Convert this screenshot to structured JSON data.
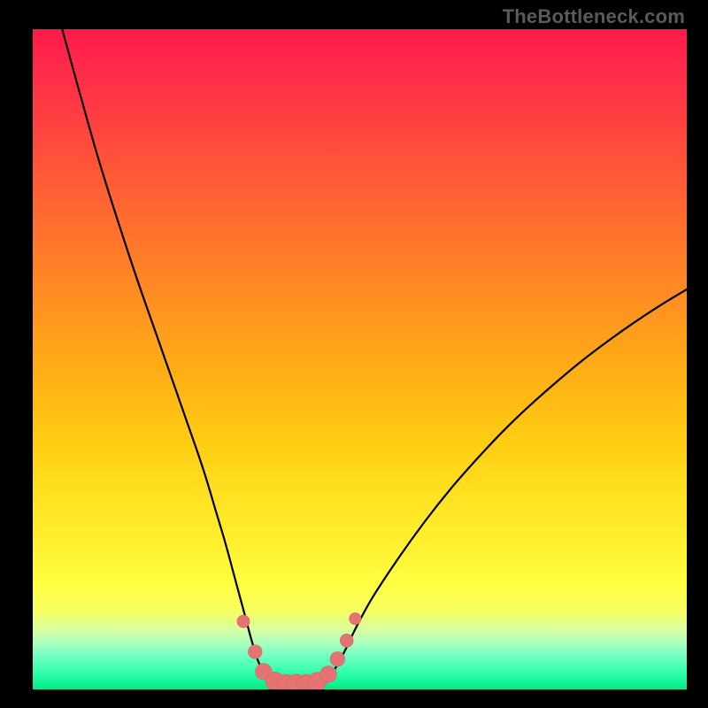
{
  "watermark": "TheBottleneck.com",
  "colors": {
    "background": "#000000",
    "curve": "#000000",
    "marker_fill": "#e57373",
    "marker_stroke": "#d86a6a",
    "gradient_top": "#ff1a4a",
    "gradient_bottom": "#08e888"
  },
  "chart_data": {
    "type": "line",
    "title": "",
    "xlabel": "",
    "ylabel": "",
    "xlim": [
      0,
      100
    ],
    "ylim": [
      0,
      100
    ],
    "grid": false,
    "legend": false,
    "series": [
      {
        "name": "left-branch",
        "x": [
          4.5,
          7,
          10,
          13,
          16,
          19,
          22,
          25,
          26.5,
          28,
          29.5,
          31,
          32.5,
          33.5,
          34.5,
          36
        ],
        "y": [
          100,
          91,
          80.5,
          71,
          62,
          53.5,
          45,
          36.5,
          32,
          27,
          22,
          16.5,
          11,
          7.3,
          4.2,
          1.2
        ]
      },
      {
        "name": "valley",
        "x": [
          36,
          37.5,
          39,
          40.5,
          42,
          43.5,
          45
        ],
        "y": [
          1.2,
          0.5,
          0.25,
          0.2,
          0.25,
          0.55,
          1.2
        ]
      },
      {
        "name": "right-branch",
        "x": [
          45,
          46.5,
          48,
          49.5,
          52,
          56,
          60,
          64,
          68,
          72,
          76,
          80,
          84,
          88,
          92,
          96,
          100
        ],
        "y": [
          1.2,
          3.6,
          6.4,
          9.5,
          14,
          20,
          25.5,
          30.5,
          35,
          39.2,
          43,
          46.5,
          49.8,
          52.8,
          55.6,
          58.2,
          60.6
        ]
      }
    ],
    "markers": [
      {
        "x": 32.2,
        "y": 10.3,
        "r": 0.95
      },
      {
        "x": 34.0,
        "y": 5.7,
        "r": 1.05
      },
      {
        "x": 35.3,
        "y": 2.7,
        "r": 1.25
      },
      {
        "x": 37.0,
        "y": 1.25,
        "r": 1.4
      },
      {
        "x": 38.8,
        "y": 0.85,
        "r": 1.4
      },
      {
        "x": 40.3,
        "y": 0.8,
        "r": 1.5
      },
      {
        "x": 41.8,
        "y": 0.85,
        "r": 1.4
      },
      {
        "x": 43.5,
        "y": 1.2,
        "r": 1.4
      },
      {
        "x": 45.2,
        "y": 2.3,
        "r": 1.25
      },
      {
        "x": 46.6,
        "y": 4.6,
        "r": 1.1
      },
      {
        "x": 48.0,
        "y": 7.4,
        "r": 1.0
      },
      {
        "x": 49.3,
        "y": 10.7,
        "r": 0.9
      }
    ]
  }
}
